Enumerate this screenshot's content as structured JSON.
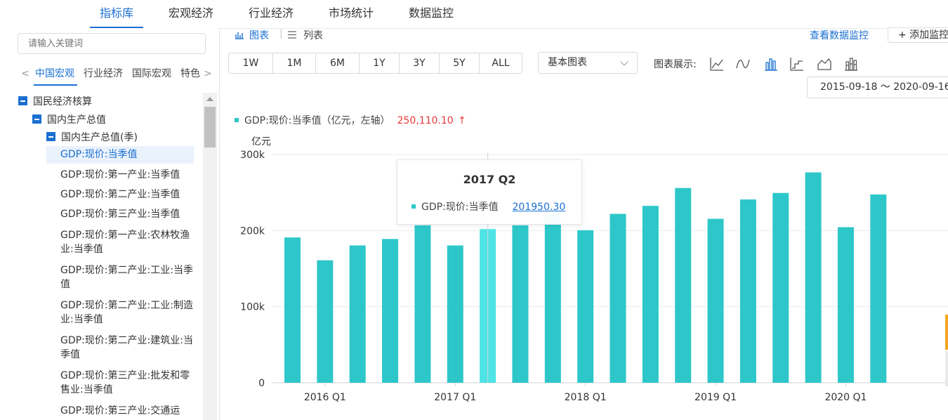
{
  "topnav": {
    "tabs": [
      "指标库",
      "宏观经济",
      "行业经济",
      "市场统计",
      "数据监控"
    ],
    "active_index": 0
  },
  "sidebar": {
    "search_placeholder": "请输入关键词",
    "category_tabs": {
      "prev": "<",
      "items": [
        "中国宏观",
        "行业经济",
        "国际宏观",
        "特色"
      ],
      "next": ">",
      "active_index": 0
    },
    "tree": {
      "level1": "国民经济核算",
      "level2": "国内生产总值",
      "level3": "国内生产总值(季)",
      "leaves": [
        [
          "GDP:现价:当季值"
        ],
        [
          "GDP:现价:第一产业:当季值"
        ],
        [
          "GDP:现价:第二产业:当季值"
        ],
        [
          "GDP:现价:第三产业:当季值"
        ],
        [
          "GDP:现价:第一产业:农林牧渔",
          "业:当季值"
        ],
        [
          "GDP:现价:第二产业:工业:当季",
          "值"
        ],
        [
          "GDP:现价:第二产业:工业:制造",
          "业:当季值"
        ],
        [
          "GDP:现价:第二产业:建筑业:当",
          "季值"
        ],
        [
          "GDP:现价:第三产业:批发和零",
          "售业:当季值"
        ],
        [
          "GDP:现价:第三产业:交通运"
        ]
      ],
      "selected_index": 0
    }
  },
  "main": {
    "view_tabs": {
      "chart": "图表",
      "list": "列表"
    },
    "monitor_link": "查看数据监控",
    "add_monitor": "+ 添加监控",
    "range_buttons": [
      "1W",
      "1M",
      "6M",
      "1Y",
      "3Y",
      "5Y",
      "ALL"
    ],
    "chart_style_select": "基本图表",
    "chart_display_label": "图表展示:",
    "chart_type_icons": [
      "line-chart-icon",
      "curve-chart-icon",
      "bar-chart-icon",
      "step-chart-icon",
      "area-chart-icon",
      "stacked-bar-chart-icon"
    ],
    "date_range": "2015-09-18 ～ 2020-09-16",
    "legend": {
      "label": "GDP:现价:当季值（亿元，左轴）",
      "value": "250,110.10",
      "trend": "↑"
    },
    "tooltip": {
      "title": "2017 Q2",
      "series": "GDP:现价:当季值",
      "value": "201950.30"
    }
  },
  "colors": {
    "accent": "#1a6fd1",
    "bar": "#2ec7c9",
    "bar_highlight": "#4ee3e4",
    "up": "#e53935"
  },
  "chart_data": {
    "type": "bar",
    "ylabel": "亿元",
    "ylim": [
      0,
      300000
    ],
    "y_ticks": [
      "0",
      "100k",
      "200k",
      "300k"
    ],
    "x_tick_labels": [
      "2016 Q1",
      "2017 Q1",
      "2018 Q1",
      "2019 Q1",
      "2020 Q1"
    ],
    "categories": [
      "2015 Q4",
      "2016 Q1",
      "2016 Q2",
      "2016 Q3",
      "2016 Q4",
      "2017 Q1",
      "2017 Q2",
      "2017 Q3",
      "2017 Q4",
      "2018 Q1",
      "2018 Q2",
      "2018 Q3",
      "2018 Q4",
      "2019 Q1",
      "2019 Q2",
      "2019 Q3",
      "2019 Q4",
      "2020 Q1",
      "2020 Q2"
    ],
    "series": [
      {
        "values": [
          191000,
          161000,
          180500,
          189000,
          207000,
          180500,
          201950,
          207000,
          222000,
          200500,
          222000,
          232500,
          256000,
          215500,
          241000,
          249500,
          276500,
          204500,
          247500
        ]
      }
    ],
    "highlight_category": "2017 Q2",
    "grid": true
  }
}
